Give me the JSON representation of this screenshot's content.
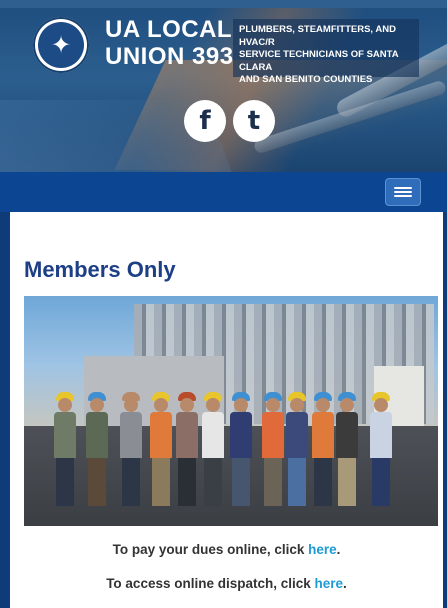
{
  "header": {
    "title_line1": "UA LOCAL",
    "title_line2": "UNION 393",
    "subtitle_line1": "PLUMBERS, STEAMFITTERS, AND HVAC/R",
    "subtitle_line2": "SERVICE TECHNICIANS OF SANTA CLARA",
    "subtitle_line3": "AND SAN BENITO COUNTIES",
    "logo_icon": "ua-seal-icon",
    "social": [
      {
        "name": "facebook-icon",
        "glyph": "f"
      },
      {
        "name": "twitter-icon",
        "glyph": "t"
      }
    ]
  },
  "nav": {
    "menu_icon": "hamburger-menu-icon"
  },
  "main": {
    "title": "Members Only",
    "dues_text": "To pay your dues online, click ",
    "dues_link": "here",
    "dues_end": ".",
    "dispatch_text": "To access online dispatch, click ",
    "dispatch_link": "here",
    "dispatch_end": "."
  },
  "colors": {
    "nav_bar": "#0c4591",
    "title": "#1d3f86",
    "link": "#1e9bd6"
  }
}
